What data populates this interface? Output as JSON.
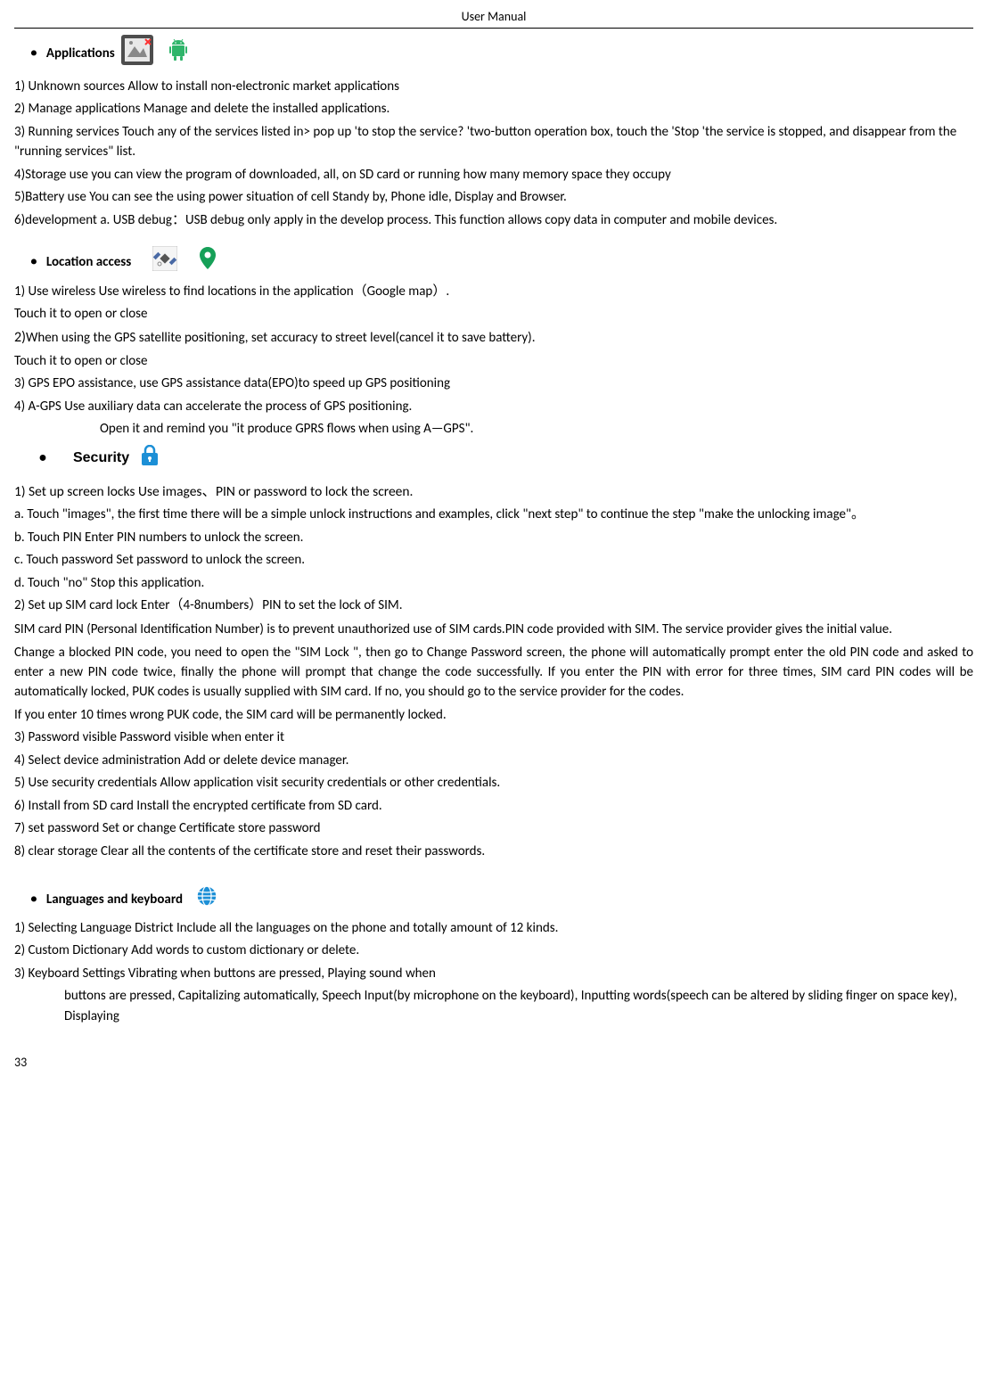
{
  "header": "User  Manual",
  "pageNumber": "33",
  "sections": {
    "applications": {
      "title": "Applications",
      "items": {
        "i1": "1) Unknown sources               Allow to install non-electronic market applications",
        "i2": "2) Manage applications           Manage and delete the installed applications.",
        "i3": "3) Running services          Touch any of the services listed in> pop up 'to stop the service? 'two-button operation box, touch the 'Stop 'the service is stopped, and disappear from the \"running services\" list.",
        "i4": "4)Storage use             you can view the program of downloaded, all, on SD card or running  how many memory space they occupy",
        "i5": "5)Battery use        You can see the using power situation of cell Standy by, Phone idle, Display and Browser.",
        "i6": "6)development             a. USB debug：USB debug only apply in the develop process. This function allows copy data in computer and mobile devices."
      }
    },
    "location": {
      "title": "Location  access",
      "items": {
        "i1": "1) Use wireless            Use wireless to find locations in the application（Google map）.",
        "i1b": "Touch it to open or close",
        "i2a": "2)",
        "i2b": " When using the GPS satellite positioning, set accuracy to street level(cancel it to save battery).",
        "i2c": "Touch it to open or close",
        "i3": "3) GPS EPO assistance, use GPS assistance data(EPO)to speed up GPS positioning",
        "i4": "4) A-GPS Use auxiliary data can accelerate the process of GPS positioning.",
        "i4b": "Open it and remind you \"it produce GPRS flows when using A—GPS\"."
      }
    },
    "security": {
      "title": "Security",
      "items": {
        "i1": "1)    Set up screen locks      Use images、PIN or password to lock the screen.",
        "a": "a. Touch \"images\", the first time there will be a simple unlock instructions and examples, click \"next step\" to continue the step \"make the unlocking image\"。",
        "b": "b. Touch PIN Enter PIN numbers to unlock the screen.",
        "c": "c. Touch password   Set password to unlock the screen.",
        "d": "d. Touch \"no\"      Stop this application.",
        "i2": "2)  Set up SIM card lock         Enter（4-8numbers）PIN to set the lock of SIM.",
        "p1": "SIM card PIN (Personal Identification Number) is to prevent unauthorized use of SIM cards.PIN code provided with SIM. The service provider gives the initial value.",
        "p2": "Change a blocked PIN code, you need to open the \"SIM Lock \", then go to Change Password screen, the phone will automatically prompt enter the old PIN code and asked to enter a new PIN code twice, finally the phone will prompt that change the code successfully. If you enter the PIN with error for three times, SIM card PIN codes will be automatically locked, PUK codes is usually supplied with SIM card. If no, you should go to the service provider for the codes.",
        "p3": "If you enter 10 times wrong PUK code, the SIM card will be permanently locked.",
        "i3": "3)  Password visible        Password visible when enter it",
        "i4": "4)  Select device administration      Add or delete device manager.",
        "i5": "5)  Use security credentials        Allow application visit security credentials or other credentials.",
        "i6": "6)  Install from SD card      Install the encrypted certificate from SD card.",
        "i7": "7)  set password        Set or change Certificate store password",
        "i8": "8)  clear storage        Clear all the contents of the certificate store and reset their passwords."
      }
    },
    "languages": {
      "title": "Languages and keyboard",
      "items": {
        "i1": "1) Selecting Language District         Include all the languages on the phone and totally amount of 12 kinds.",
        "i2": "2) Custom Dictionary          Add words to custom dictionary or delete.",
        "i3": "3) Keyboard Settings        Vibrating when buttons are pressed, Playing sound when",
        "i3b": "buttons are pressed, Capitalizing automatically, Speech Input(by microphone on the keyboard), Inputting words(speech can be altered by sliding finger on space key), Displaying"
      }
    }
  }
}
